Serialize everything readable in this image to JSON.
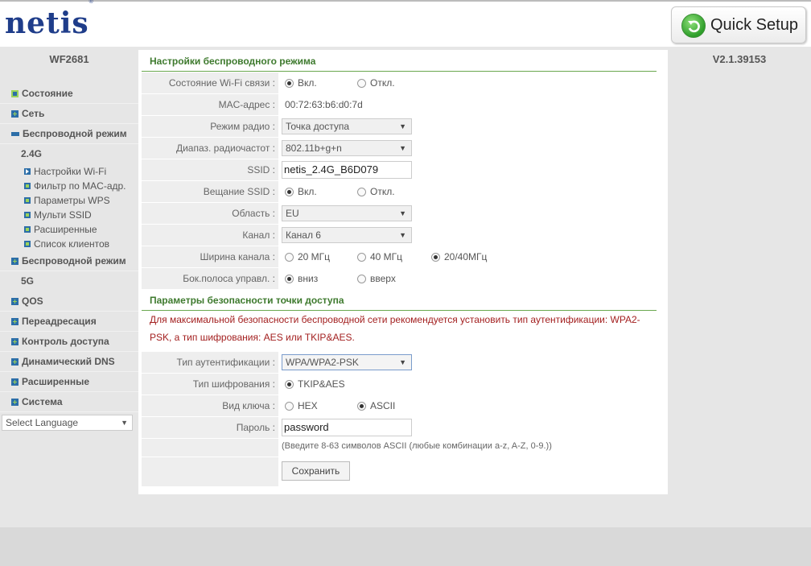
{
  "header": {
    "logo_text": "netis",
    "logo_mark": "®",
    "quick_setup_label": "Quick Setup",
    "quick_setup_icon": "refresh-arrow-icon"
  },
  "model": "WF2681",
  "version": "V2.1.39153",
  "sidebar": {
    "items": [
      {
        "label": "Состояние"
      },
      {
        "label": "Сеть"
      },
      {
        "label": "Беспроводной режим"
      },
      {
        "label": "2.4G"
      },
      {
        "label": "Беспроводной режим"
      },
      {
        "label": "5G"
      },
      {
        "label": "QOS"
      },
      {
        "label": "Переадресация"
      },
      {
        "label": "Контроль доступа"
      },
      {
        "label": "Динамический DNS"
      },
      {
        "label": "Расширенные"
      },
      {
        "label": "Система"
      }
    ],
    "subitems": [
      {
        "label": "Настройки Wi-Fi"
      },
      {
        "label": "Фильтр по MAC-адр."
      },
      {
        "label": "Параметры WPS"
      },
      {
        "label": "Мульти SSID"
      },
      {
        "label": "Расширенные"
      },
      {
        "label": "Список клиентов"
      }
    ],
    "language_select": "Select Language"
  },
  "wireless": {
    "title": "Настройки беспроводного режима",
    "wifi_state_label": "Состояние Wi-Fi связи :",
    "wifi_on": "Вкл.",
    "wifi_off": "Откл.",
    "mac_label": "MAC-адрес :",
    "mac_value": "00:72:63:b6:d0:7d",
    "radio_mode_label": "Режим радио :",
    "radio_mode_value": "Точка доступа",
    "band_label": "Диапаз. радиочастот :",
    "band_value": "802.11b+g+n",
    "ssid_label": "SSID :",
    "ssid_value": "netis_2.4G_B6D079",
    "broadcast_label": "Вещание SSID :",
    "broadcast_on": "Вкл.",
    "broadcast_off": "Откл.",
    "region_label": "Область :",
    "region_value": "EU",
    "channel_label": "Канал :",
    "channel_value": "Канал 6",
    "width_label": "Ширина канала :",
    "width_20": "20 МГц",
    "width_40": "40 МГц",
    "width_2040": "20/40МГц",
    "sideband_label": "Бок.полоса управл. :",
    "sideband_down": "вниз",
    "sideband_up": "вверх"
  },
  "security": {
    "title": "Параметры безопасности точки доступа",
    "warning_line1": "Для максимальной безопасности беспроводной сети рекомендуется установить тип аутентификации: WPA2-",
    "warning_line2": "PSK, а тип шифрования: AES или TKIP&AES.",
    "auth_label": "Тип аутентификации :",
    "auth_value": "WPA/WPA2-PSK",
    "cipher_label": "Тип шифрования :",
    "cipher_value": "TKIP&AES",
    "key_type_label": "Вид ключа :",
    "key_hex": "HEX",
    "key_ascii": "ASCII",
    "password_label": "Пароль :",
    "password_value": "password",
    "hint": "(Введите 8-63 символов ASCII (любые комбинации a-z, A-Z, 0-9.))",
    "save_label": "Сохранить"
  }
}
